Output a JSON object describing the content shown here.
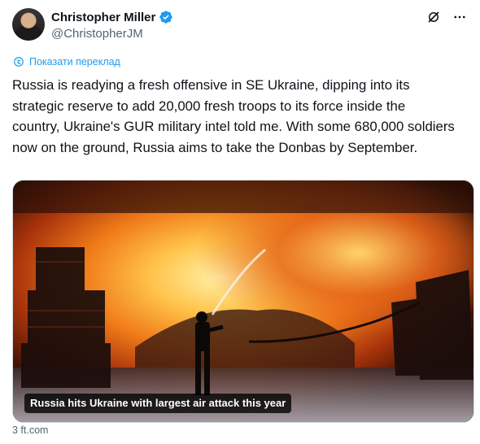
{
  "author": {
    "name": "Christopher Miller",
    "handle": "@ChristopherJM",
    "verified": true,
    "verified_color": "#1d9bf0"
  },
  "header_icons": [
    "grok-icon",
    "more-icon"
  ],
  "translate_link": "Показати переклад",
  "tweet_text": "Russia is readying a fresh offensive in SE Ukraine, dipping into its strategic reserve to add 20,000 fresh troops to its force inside the country, Ukraine's GUR military intel told me. With some 680,000 soldiers now on the ground, Russia aims to take the Donbas by September.",
  "media": {
    "caption": "Russia hits Ukraine with largest air attack this year",
    "description_icon": "photo"
  },
  "link_source": "3 ft.com",
  "colors": {
    "accent": "#1d9bf0",
    "text": "#0f1419",
    "muted": "#536471"
  }
}
